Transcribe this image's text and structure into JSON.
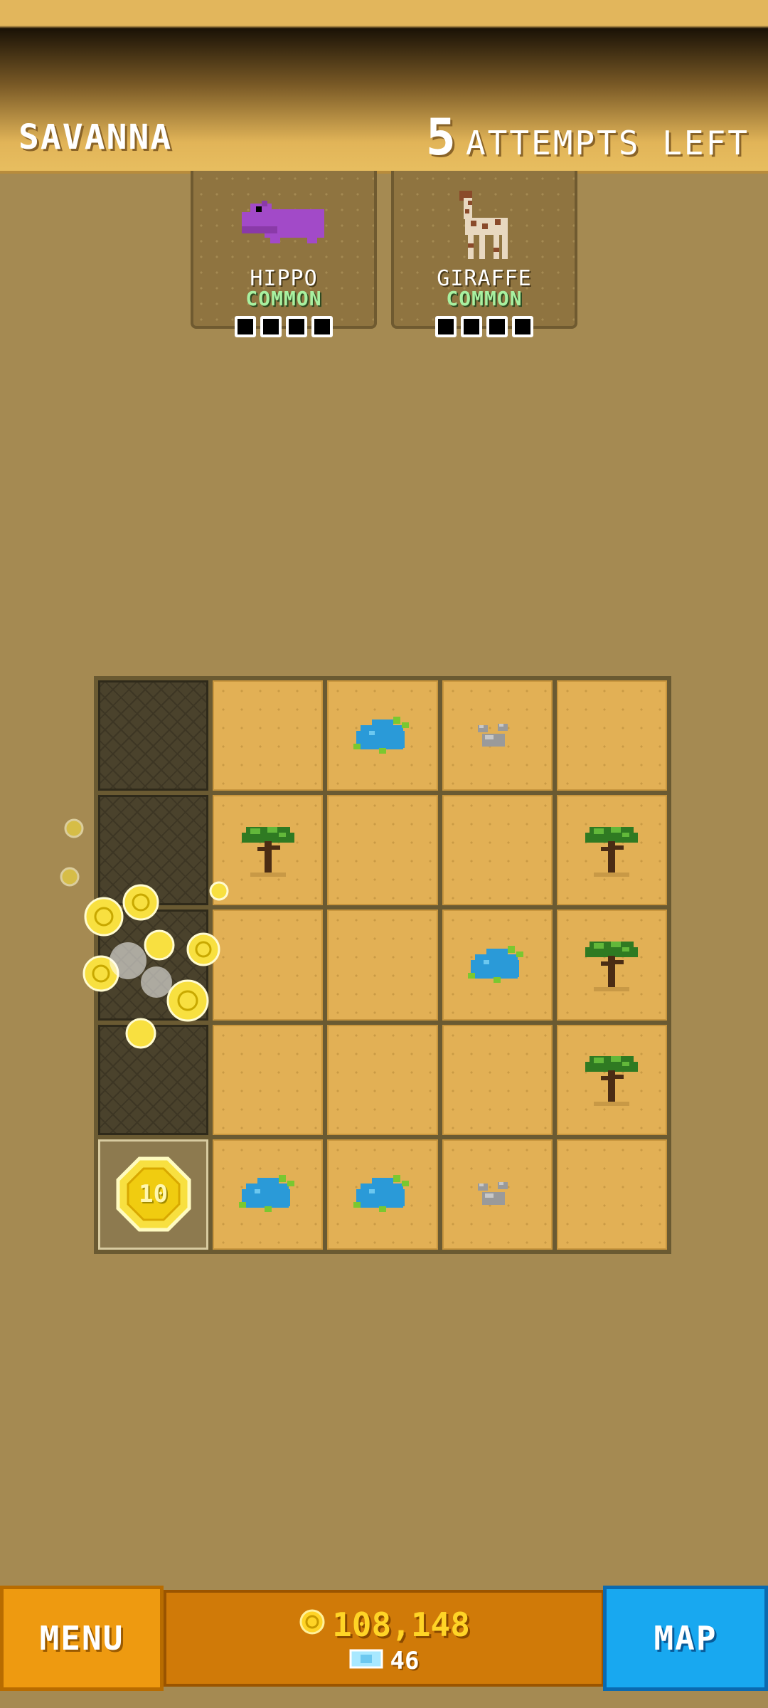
{
  "header": {
    "zone": "SAVANNA",
    "attempts_count": "5",
    "attempts_label": "ATTEMPTS LEFT"
  },
  "cards": [
    {
      "name": "HIPPO",
      "rarity": "COMMON",
      "icon": "hippo-icon",
      "slots": 4
    },
    {
      "name": "GIRAFFE",
      "rarity": "COMMON",
      "icon": "giraffe-icon",
      "slots": 4
    }
  ],
  "grid": {
    "rows": [
      [
        "dug",
        "sand",
        "water",
        "rock",
        "sand"
      ],
      [
        "dug",
        "tree",
        "sand",
        "sand",
        "tree"
      ],
      [
        "dug",
        "sand",
        "sand",
        "water",
        "tree"
      ],
      [
        "dug",
        "sand",
        "sand",
        "sand",
        "tree"
      ],
      [
        "coin",
        "water",
        "water",
        "rock",
        "sand"
      ]
    ],
    "coin_value": "10"
  },
  "footer": {
    "menu_label": "MENU",
    "coins": "108,148",
    "gems": "46",
    "map_label": "MAP"
  },
  "colors": {
    "background": "#a58a52",
    "sand_tile": "#e2b055",
    "rarity_common": "#a8f0a0",
    "menu_button": "#ee9a10",
    "map_button": "#18a8f0",
    "coin_text": "#ffd426"
  }
}
